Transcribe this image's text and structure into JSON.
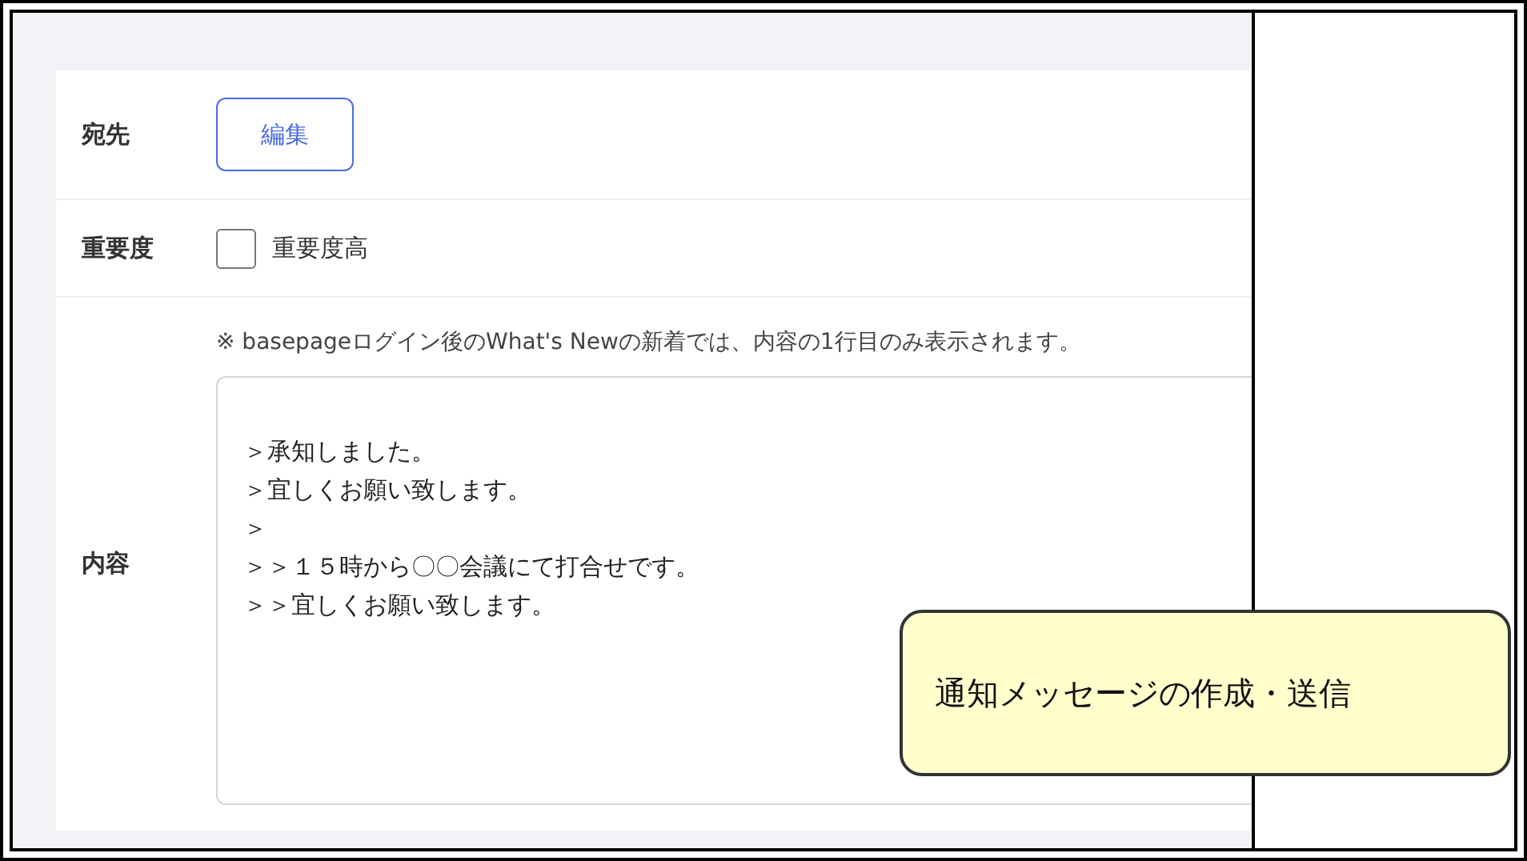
{
  "form": {
    "rows": [
      {
        "kind": "button",
        "label": "宛先",
        "button": "編集"
      },
      {
        "kind": "checkbox",
        "label": "重要度",
        "checkbox": {
          "label": "重要度高",
          "checked": false
        }
      },
      {
        "kind": "textarea",
        "label": "内容",
        "note": "※ basepageログイン後のWhat's Newの新着では、内容の1行目のみ表示されます。",
        "value": [
          "＞承知しました。",
          "＞宜しくお願い致します。",
          "＞",
          "＞＞１５時から〇〇会議にて打合せです。",
          "＞＞宜しくお願い致します。"
        ]
      }
    ]
  },
  "callout": {
    "text": "通知メッセージの作成・送信"
  }
}
